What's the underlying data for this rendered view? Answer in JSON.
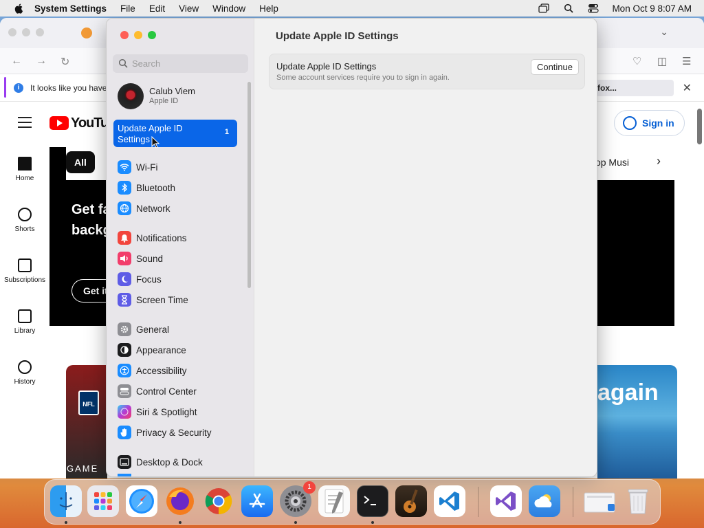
{
  "menubar": {
    "app_name": "System Settings",
    "menus": [
      "File",
      "Edit",
      "View",
      "Window",
      "Help"
    ],
    "clock": "Mon Oct 9  8:07 AM"
  },
  "browser": {
    "notice_text": "It looks like you haven",
    "notice_right": "fox...",
    "youtube": {
      "logo_text": "YouTub",
      "sidebar": [
        "Home",
        "Shorts",
        "Subscriptions",
        "Library",
        "History"
      ],
      "chip_all": "All",
      "chip_music": "op Musi",
      "hero_line1": "Get fa",
      "hero_line2": "backg",
      "hero_button": "Get it",
      "sign_in": "Sign in",
      "thumb_right_text": "again",
      "thumb_left_badge": "NFL",
      "thumb_left_text": "GAME"
    }
  },
  "settings": {
    "search_placeholder": "Search",
    "account": {
      "name": "Calub Viem",
      "sub": "Apple ID"
    },
    "selected": {
      "label": "Update Apple ID Settings",
      "count": "1"
    },
    "sidebar_groups": [
      [
        {
          "label": "Wi-Fi",
          "icon": "wifi-icon",
          "color": "#1a8cff"
        },
        {
          "label": "Bluetooth",
          "icon": "bluetooth-icon",
          "color": "#1a8cff"
        },
        {
          "label": "Network",
          "icon": "globe-icon",
          "color": "#1a8cff"
        }
      ],
      [
        {
          "label": "Notifications",
          "icon": "bell-icon",
          "color": "#f2453d"
        },
        {
          "label": "Sound",
          "icon": "speaker-icon",
          "color": "#f23d6b"
        },
        {
          "label": "Focus",
          "icon": "moon-icon",
          "color": "#5e5ce6"
        },
        {
          "label": "Screen Time",
          "icon": "hourglass-icon",
          "color": "#5e5ce6"
        }
      ],
      [
        {
          "label": "General",
          "icon": "gear-icon",
          "color": "#8e8e93"
        },
        {
          "label": "Appearance",
          "icon": "appearance-icon",
          "color": "#1c1c1e"
        },
        {
          "label": "Accessibility",
          "icon": "accessibility-icon",
          "color": "#1a8cff"
        },
        {
          "label": "Control Center",
          "icon": "control-center-icon",
          "color": "#8e8e93"
        },
        {
          "label": "Siri & Spotlight",
          "icon": "siri-icon",
          "color": "#b33ad6"
        },
        {
          "label": "Privacy & Security",
          "icon": "hand-icon",
          "color": "#1a8cff"
        }
      ],
      [
        {
          "label": "Desktop & Dock",
          "icon": "dock-icon",
          "color": "#1c1c1e"
        }
      ]
    ],
    "main": {
      "title": "Update Apple ID Settings",
      "card_title": "Update Apple ID Settings",
      "card_subtitle": "Some account services require you to sign in again.",
      "continue_label": "Continue"
    }
  },
  "dock": {
    "apps": [
      {
        "name": "Finder",
        "icon": "finder-icon",
        "running": true
      },
      {
        "name": "Launchpad",
        "icon": "launchpad-icon",
        "running": false
      },
      {
        "name": "Safari",
        "icon": "safari-icon",
        "running": false
      },
      {
        "name": "Firefox",
        "icon": "firefox-icon",
        "running": true
      },
      {
        "name": "Chrome",
        "icon": "chrome-icon",
        "running": false
      },
      {
        "name": "App Store",
        "icon": "app-store-icon",
        "running": false
      },
      {
        "name": "System Settings",
        "icon": "system-settings-icon",
        "running": true,
        "badge": "1"
      },
      {
        "name": "TextEdit",
        "icon": "textedit-icon",
        "running": false
      },
      {
        "name": "Terminal",
        "icon": "terminal-icon",
        "running": true
      },
      {
        "name": "GarageBand",
        "icon": "garageband-icon",
        "running": false
      },
      {
        "name": "Visual Studio Code",
        "icon": "vscode-icon",
        "running": false
      },
      {
        "name": "Visual Studio",
        "icon": "visual-studio-icon",
        "running": false
      },
      {
        "name": "Weather",
        "icon": "weather-icon",
        "running": false
      },
      {
        "name": "Downloads",
        "icon": "downloads-icon",
        "running": false
      },
      {
        "name": "Trash",
        "icon": "trash-icon",
        "running": false
      }
    ]
  }
}
